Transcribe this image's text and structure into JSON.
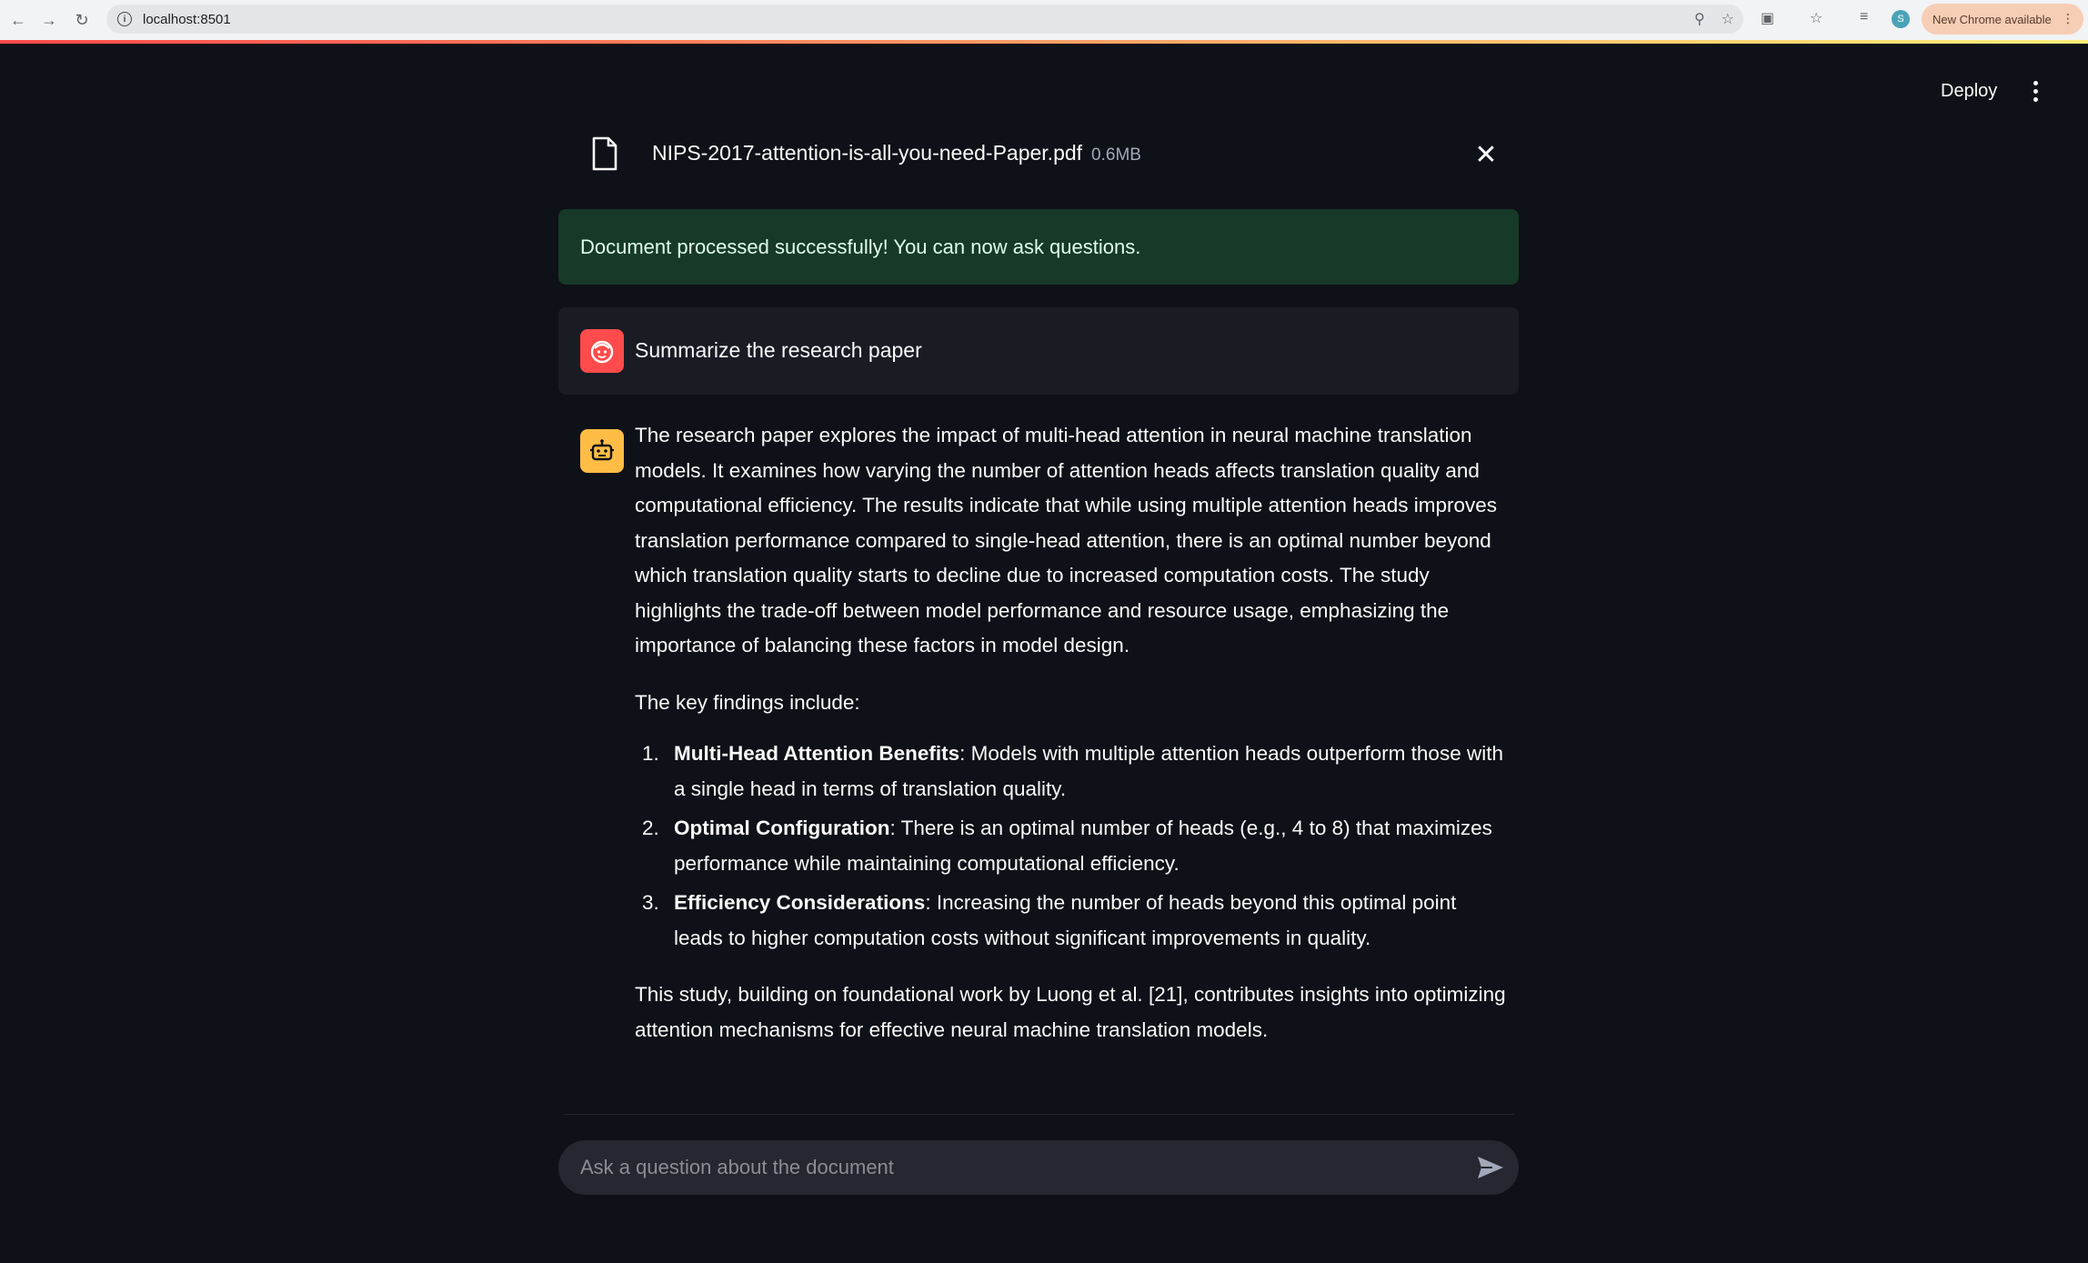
{
  "browser": {
    "url": "localhost:8501",
    "update_label": "New Chrome available",
    "profile_initial": "S"
  },
  "header": {
    "deploy_label": "Deploy"
  },
  "file": {
    "name": "NIPS-2017-attention-is-all-you-need-Paper.pdf",
    "size": "0.6MB"
  },
  "status": {
    "success_message": "Document processed successfully! You can now ask questions."
  },
  "chat": {
    "user_message": "Summarize the research paper",
    "assistant": {
      "intro": "The research paper explores the impact of multi-head attention in neural machine translation models. It examines how varying the number of attention heads affects translation quality and computational efficiency. The results indicate that while using multiple attention heads improves translation performance compared to single-head attention, there is an optimal number beyond which translation quality starts to decline due to increased computation costs. The study highlights the trade-off between model performance and resource usage, emphasizing the importance of balancing these factors in model design.",
      "findings_heading": "The key findings include:",
      "findings": [
        {
          "num": "1.",
          "title": "Multi-Head Attention Benefits",
          "text": ": Models with multiple attention heads outperform those with a single head in terms of translation quality."
        },
        {
          "num": "2.",
          "title": "Optimal Configuration",
          "text": ": There is an optimal number of heads (e.g., 4 to 8) that maximizes performance while maintaining computational efficiency."
        },
        {
          "num": "3.",
          "title": "Efficiency Considerations",
          "text": ": Increasing the number of heads beyond this optimal point leads to higher computation costs without significant improvements in quality."
        }
      ],
      "conclusion": "This study, building on foundational work by Luong et al. [21], contributes insights into optimizing attention mechanisms for effective neural machine translation models."
    },
    "input_placeholder": "Ask a question about the document"
  },
  "colors": {
    "background": "#0e1117",
    "success_bg": "#173928",
    "user_avatar": "#ff4b4b",
    "bot_avatar": "#ffbd45"
  },
  "icons": [
    "back-icon",
    "forward-icon",
    "reload-icon",
    "info-icon",
    "zoom-icon",
    "star-icon",
    "extensions-icon",
    "bookmark-icon",
    "reading-list-icon",
    "file-icon",
    "close-icon",
    "user-avatar-icon",
    "bot-avatar-icon",
    "send-icon",
    "kebab-menu-icon"
  ]
}
